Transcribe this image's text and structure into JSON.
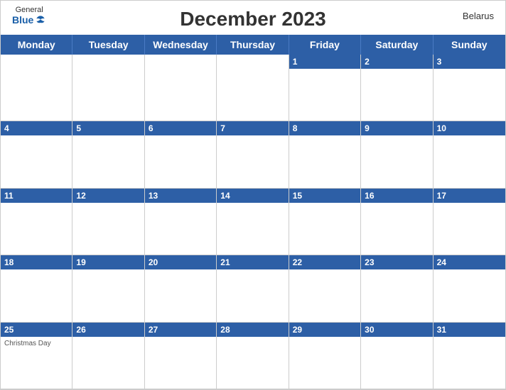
{
  "header": {
    "title": "December 2023",
    "country": "Belarus",
    "logo_general": "General",
    "logo_blue": "Blue"
  },
  "days": [
    "Monday",
    "Tuesday",
    "Wednesday",
    "Thursday",
    "Friday",
    "Saturday",
    "Sunday"
  ],
  "weeks": [
    [
      {
        "num": "",
        "empty": true
      },
      {
        "num": "",
        "empty": true
      },
      {
        "num": "",
        "empty": true
      },
      {
        "num": "",
        "empty": true
      },
      {
        "num": "1",
        "event": ""
      },
      {
        "num": "2",
        "event": ""
      },
      {
        "num": "3",
        "event": ""
      }
    ],
    [
      {
        "num": "4",
        "event": ""
      },
      {
        "num": "5",
        "event": ""
      },
      {
        "num": "6",
        "event": ""
      },
      {
        "num": "7",
        "event": ""
      },
      {
        "num": "8",
        "event": ""
      },
      {
        "num": "9",
        "event": ""
      },
      {
        "num": "10",
        "event": ""
      }
    ],
    [
      {
        "num": "11",
        "event": ""
      },
      {
        "num": "12",
        "event": ""
      },
      {
        "num": "13",
        "event": ""
      },
      {
        "num": "14",
        "event": ""
      },
      {
        "num": "15",
        "event": ""
      },
      {
        "num": "16",
        "event": ""
      },
      {
        "num": "17",
        "event": ""
      }
    ],
    [
      {
        "num": "18",
        "event": ""
      },
      {
        "num": "19",
        "event": ""
      },
      {
        "num": "20",
        "event": ""
      },
      {
        "num": "21",
        "event": ""
      },
      {
        "num": "22",
        "event": ""
      },
      {
        "num": "23",
        "event": ""
      },
      {
        "num": "24",
        "event": ""
      }
    ],
    [
      {
        "num": "25",
        "event": "Christmas Day"
      },
      {
        "num": "26",
        "event": ""
      },
      {
        "num": "27",
        "event": ""
      },
      {
        "num": "28",
        "event": ""
      },
      {
        "num": "29",
        "event": ""
      },
      {
        "num": "30",
        "event": ""
      },
      {
        "num": "31",
        "event": ""
      }
    ]
  ]
}
